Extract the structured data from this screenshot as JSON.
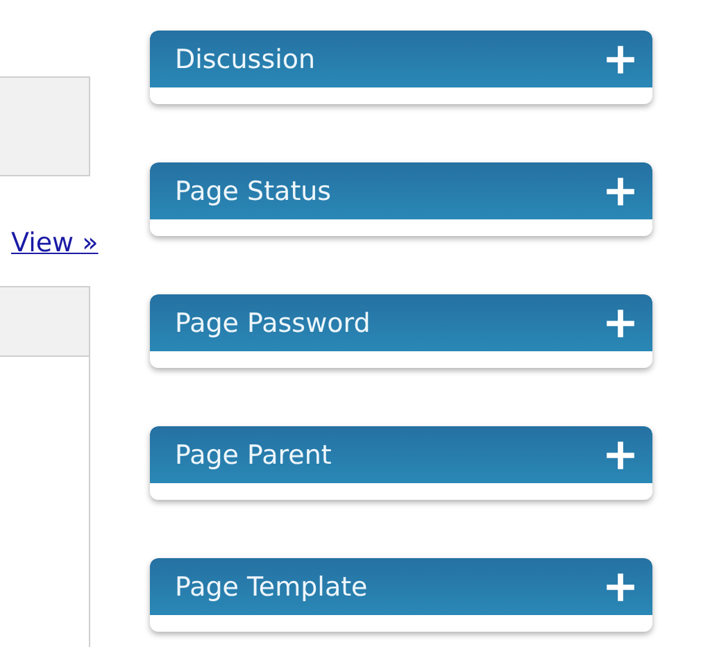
{
  "view_link": "View »",
  "panels": [
    {
      "title": "Discussion",
      "expanded": false
    },
    {
      "title": "Page Status",
      "expanded": false
    },
    {
      "title": "Page Password",
      "expanded": false
    },
    {
      "title": "Page Parent",
      "expanded": false
    },
    {
      "title": "Page Template",
      "expanded": false
    }
  ]
}
